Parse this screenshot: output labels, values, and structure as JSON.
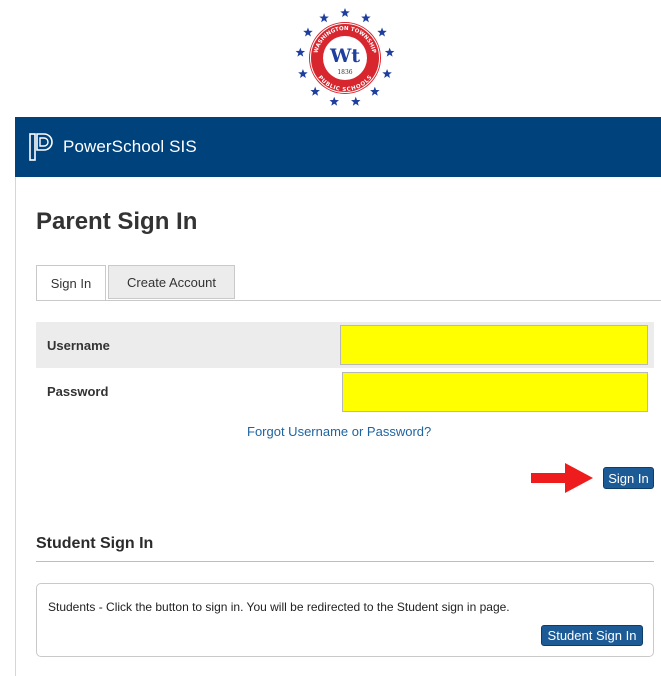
{
  "logo": {
    "text_top": "WASHINGTON TOWNSHIP",
    "text_bottom": "PUBLIC SCHOOLS",
    "initials": "Wt",
    "year": "1836",
    "icon": "school-seal"
  },
  "header": {
    "brand_icon": "powerschool-p-icon",
    "title": "PowerSchool SIS",
    "background_color": "#00427c"
  },
  "main": {
    "page_title": "Parent Sign In",
    "tabs": [
      {
        "label": "Sign In",
        "active": true
      },
      {
        "label": "Create Account",
        "active": false
      }
    ],
    "username": {
      "label": "Username",
      "value": ""
    },
    "password": {
      "label": "Password",
      "value": ""
    },
    "forgot_link": "Forgot Username or Password?",
    "sign_in_button": "Sign In",
    "arrow_icon": "red-arrow-right-icon",
    "highlight_color": "#ffff00",
    "accent_color": "#1c5b96"
  },
  "student": {
    "title": "Student Sign In",
    "message": "Students - Click the button to sign in. You will be redirected to the Student sign in page.",
    "button": "Student Sign In"
  }
}
